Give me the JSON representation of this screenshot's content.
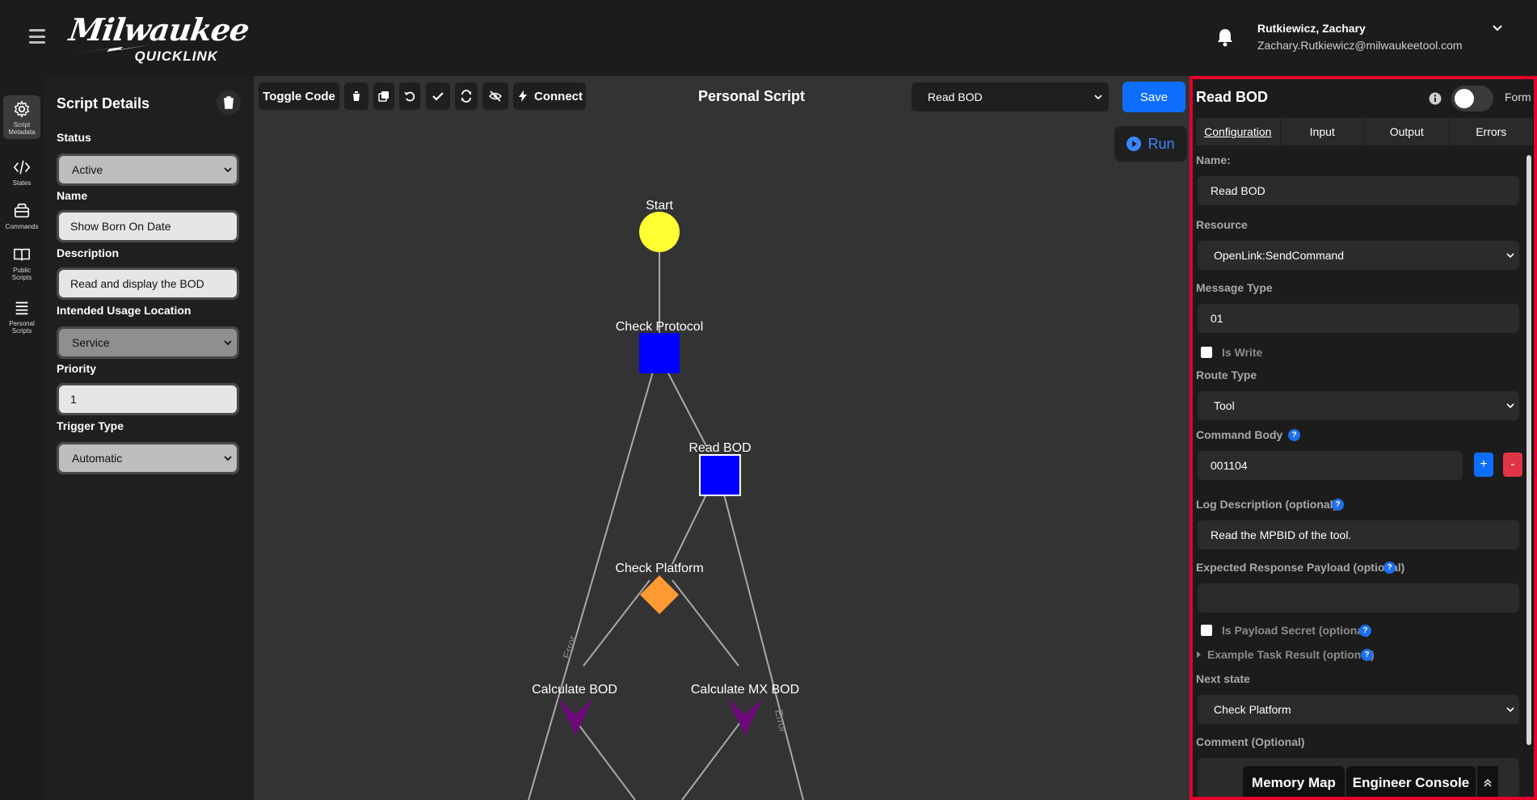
{
  "header": {
    "brand": "Milwaukee",
    "sub_brand": "QUICKLINK",
    "user_name": "Rutkiewicz, Zachary",
    "user_email": "Zachary.Rutkiewicz@milwaukeetool.com"
  },
  "rail": {
    "items": [
      {
        "label": "Script Metadata",
        "icon": "gear-icon",
        "active": true
      },
      {
        "label": "States",
        "icon": "code-icon"
      },
      {
        "label": "Commands",
        "icon": "commands-icon"
      },
      {
        "label": "Public Scripts",
        "icon": "book-icon"
      },
      {
        "label": "Personal Scripts",
        "icon": "list-icon"
      }
    ]
  },
  "details": {
    "title": "Script Details",
    "status_label": "Status",
    "status_value": "Active",
    "name_label": "Name",
    "name_value": "Show Born On Date",
    "description_label": "Description",
    "description_value": "Read and display the BOD",
    "usage_label": "Intended Usage Location",
    "usage_value": "Service",
    "priority_label": "Priority",
    "priority_value": "1",
    "trigger_label": "Trigger Type",
    "trigger_value": "Automatic"
  },
  "canvas": {
    "toggle_code": "Toggle Code",
    "connect": "Connect",
    "title": "Personal Script",
    "selected_state": "Read BOD",
    "save": "Save",
    "run": "Run",
    "nodes": {
      "start": "Start",
      "check_protocol": "Check Protocol",
      "read_bod": "Read BOD",
      "check_platform": "Check Platform",
      "calculate_bod": "Calculate BOD",
      "calculate_mx_bod": "Calculate MX BOD"
    },
    "edge_error_1": "Error",
    "edge_error_2": "Error",
    "colors": {
      "start": "#ffff33",
      "state": "#0000ff",
      "decision": "#ff9933",
      "calc": "#6b0a78",
      "edge": "#a9a9a9"
    }
  },
  "inspector": {
    "title": "Read BOD",
    "form_label": "Form",
    "tabs": [
      "Configuration",
      "Input",
      "Output",
      "Errors"
    ],
    "name_label": "Name:",
    "name_value": "Read BOD",
    "resource_label": "Resource",
    "resource_value": "OpenLink:SendCommand",
    "message_type_label": "Message Type",
    "message_type_value": "01",
    "is_write_label": "Is Write",
    "route_type_label": "Route Type",
    "route_type_value": "Tool",
    "command_body_label": "Command Body",
    "command_body_value": "001104",
    "plus": "+",
    "minus": "-",
    "log_desc_label": "Log Description (optional)",
    "log_desc_value": "Read the MPBID of the tool.",
    "expected_label": "Expected Response Payload (optional)",
    "expected_value": "",
    "payload_secret_label": "Is Payload Secret (optional)",
    "example_label": "Example Task Result (optional)",
    "next_state_label": "Next state",
    "next_state_value": "Check Platform",
    "comment_label": "Comment (Optional)",
    "bottom_tabs": [
      "Memory Map",
      "Engineer Console"
    ]
  }
}
